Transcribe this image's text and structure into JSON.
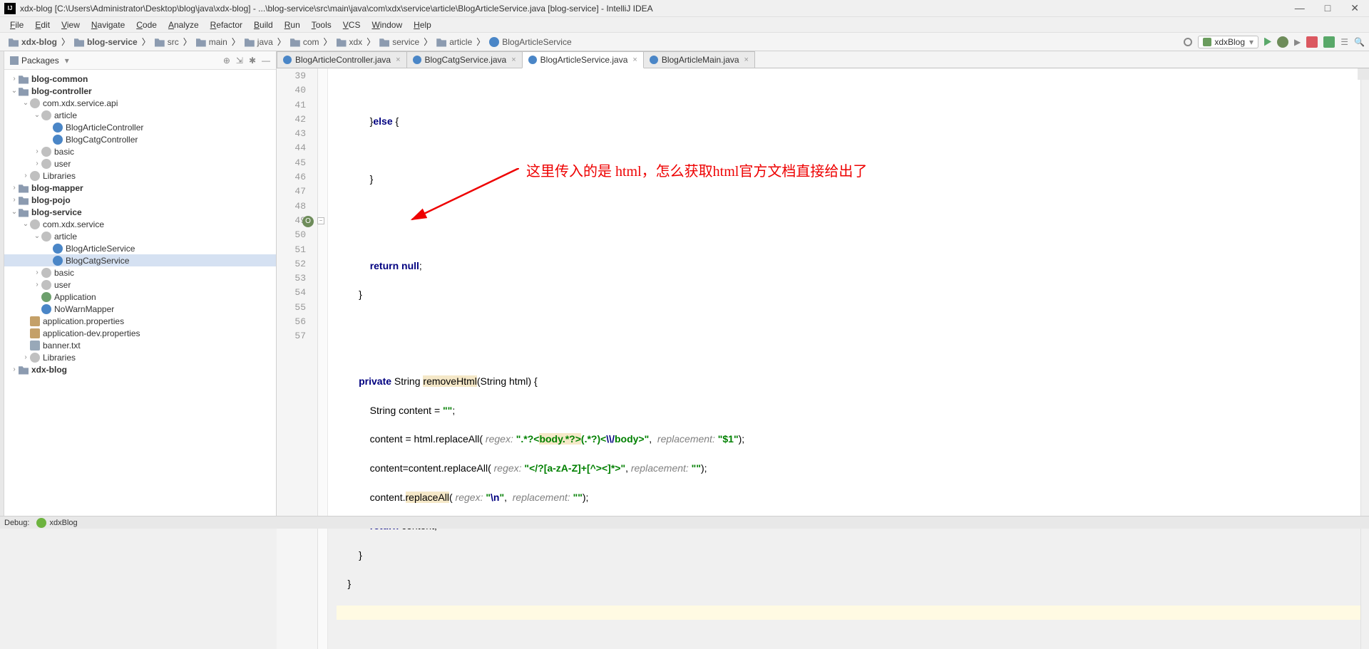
{
  "titlebar": {
    "project": "xdx-blog",
    "path": "[C:\\Users\\Administrator\\Desktop\\blog\\java\\xdx-blog]",
    "file": "...\\blog-service\\src\\main\\java\\com\\xdx\\service\\article\\BlogArticleService.java [blog-service]",
    "app": "IntelliJ IDEA"
  },
  "menu": [
    "File",
    "Edit",
    "View",
    "Navigate",
    "Code",
    "Analyze",
    "Refactor",
    "Build",
    "Run",
    "Tools",
    "VCS",
    "Window",
    "Help"
  ],
  "breadcrumbs": [
    {
      "label": "xdx-blog",
      "ico": "dir",
      "bold": true
    },
    {
      "label": "blog-service",
      "ico": "dir",
      "bold": true
    },
    {
      "label": "src",
      "ico": "dir"
    },
    {
      "label": "main",
      "ico": "dir"
    },
    {
      "label": "java",
      "ico": "dir"
    },
    {
      "label": "com",
      "ico": "dir"
    },
    {
      "label": "xdx",
      "ico": "dir"
    },
    {
      "label": "service",
      "ico": "dir"
    },
    {
      "label": "article",
      "ico": "dir"
    },
    {
      "label": "BlogArticleService",
      "ico": "class"
    }
  ],
  "run_config": "xdxBlog",
  "panel_title": "Packages",
  "tree": [
    {
      "depth": 0,
      "tw": ">",
      "ico": "dir",
      "label": "blog-common",
      "bold": true
    },
    {
      "depth": 0,
      "tw": "v",
      "ico": "dir",
      "label": "blog-controller",
      "bold": true
    },
    {
      "depth": 1,
      "tw": "v",
      "ico": "pkg",
      "label": "com.xdx.service.api"
    },
    {
      "depth": 2,
      "tw": "v",
      "ico": "pkg",
      "label": "article"
    },
    {
      "depth": 3,
      "tw": "",
      "ico": "class",
      "label": "BlogArticleController"
    },
    {
      "depth": 3,
      "tw": "",
      "ico": "class",
      "label": "BlogCatgController"
    },
    {
      "depth": 2,
      "tw": ">",
      "ico": "pkg",
      "label": "basic"
    },
    {
      "depth": 2,
      "tw": ">",
      "ico": "pkg",
      "label": "user"
    },
    {
      "depth": 1,
      "tw": ">",
      "ico": "lib",
      "label": "Libraries"
    },
    {
      "depth": 0,
      "tw": ">",
      "ico": "dir",
      "label": "blog-mapper",
      "bold": true
    },
    {
      "depth": 0,
      "tw": ">",
      "ico": "dir",
      "label": "blog-pojo",
      "bold": true
    },
    {
      "depth": 0,
      "tw": "v",
      "ico": "dir",
      "label": "blog-service",
      "bold": true
    },
    {
      "depth": 1,
      "tw": "v",
      "ico": "pkg",
      "label": "com.xdx.service"
    },
    {
      "depth": 2,
      "tw": "v",
      "ico": "pkg",
      "label": "article"
    },
    {
      "depth": 3,
      "tw": "",
      "ico": "class",
      "label": "BlogArticleService"
    },
    {
      "depth": 3,
      "tw": "",
      "ico": "class",
      "label": "BlogCatgService",
      "selected": true
    },
    {
      "depth": 2,
      "tw": ">",
      "ico": "pkg",
      "label": "basic"
    },
    {
      "depth": 2,
      "tw": ">",
      "ico": "pkg",
      "label": "user"
    },
    {
      "depth": 2,
      "tw": "",
      "ico": "java",
      "label": "Application"
    },
    {
      "depth": 2,
      "tw": "",
      "ico": "class",
      "label": "NoWarnMapper"
    },
    {
      "depth": 1,
      "tw": "",
      "ico": "prop",
      "label": "application.properties"
    },
    {
      "depth": 1,
      "tw": "",
      "ico": "prop",
      "label": "application-dev.properties"
    },
    {
      "depth": 1,
      "tw": "",
      "ico": "txt",
      "label": "banner.txt"
    },
    {
      "depth": 1,
      "tw": ">",
      "ico": "lib",
      "label": "Libraries"
    },
    {
      "depth": 0,
      "tw": ">",
      "ico": "dir",
      "label": "xdx-blog",
      "bold": true
    }
  ],
  "tabs": [
    {
      "ico": "class",
      "label": "BlogArticleController.java"
    },
    {
      "ico": "class",
      "label": "BlogCatgService.java"
    },
    {
      "ico": "class",
      "label": "BlogArticleService.java",
      "active": true
    },
    {
      "ico": "class",
      "label": "BlogArticleMain.java"
    }
  ],
  "line_start": 39,
  "line_end": 57,
  "code": {
    "l39": "",
    "l40_a": "            }",
    "l40_else": "else",
    "l40_b": " {",
    "l41": "",
    "l42": "            }",
    "l43": "",
    "l44": "",
    "l45_a": "            ",
    "l45_ret": "return",
    "l45_b": " ",
    "l45_null": "null",
    "l45_c": ";",
    "l46": "        }",
    "l47": "",
    "l48": "",
    "l49_a": "        ",
    "l49_priv": "private",
    "l49_b": " String ",
    "l49_name": "removeHtml",
    "l49_c": "(String html) {",
    "l50_a": "            String content = ",
    "l50_s": "\"\"",
    "l50_b": ";",
    "l51_a": "            content = html.replaceAll( ",
    "l51_p1": "regex:",
    "l51_s1": " \".*?<",
    "l51_body": "body.*?>",
    "l51_s1b": "(.*?)<",
    "l51_esc": "\\\\/",
    "l51_s1c": "body>\"",
    "l51_b": ",  ",
    "l51_p2": "replacement:",
    "l51_s2": " \"$1\"",
    "l51_c": ");",
    "l52_a": "            content=content.replaceAll( ",
    "l52_p1": "regex:",
    "l52_s1": " \"</?[a-zA-Z]+[^><]*>\"",
    "l52_b": ", ",
    "l52_p2": "replacement:",
    "l52_s2": " \"\"",
    "l52_c": ");",
    "l53_a": "            content.",
    "l53_name": "replaceAll",
    "l53_aa": "( ",
    "l53_p1": "regex:",
    "l53_s1": " \"",
    "l53_esc": "\\n",
    "l53_s1b": "\"",
    "l53_b": ",  ",
    "l53_p2": "replacement:",
    "l53_s2": " \"\"",
    "l53_c": ");",
    "l54_a": "            ",
    "l54_ret": "return",
    "l54_b": " content;",
    "l55": "        }",
    "l56": "    }",
    "l57": ""
  },
  "annotation": "这里传入的是 html，怎么获取html官方文档直接给出了",
  "bottom_debug": "Debug:",
  "bottom_run": "xdxBlog"
}
